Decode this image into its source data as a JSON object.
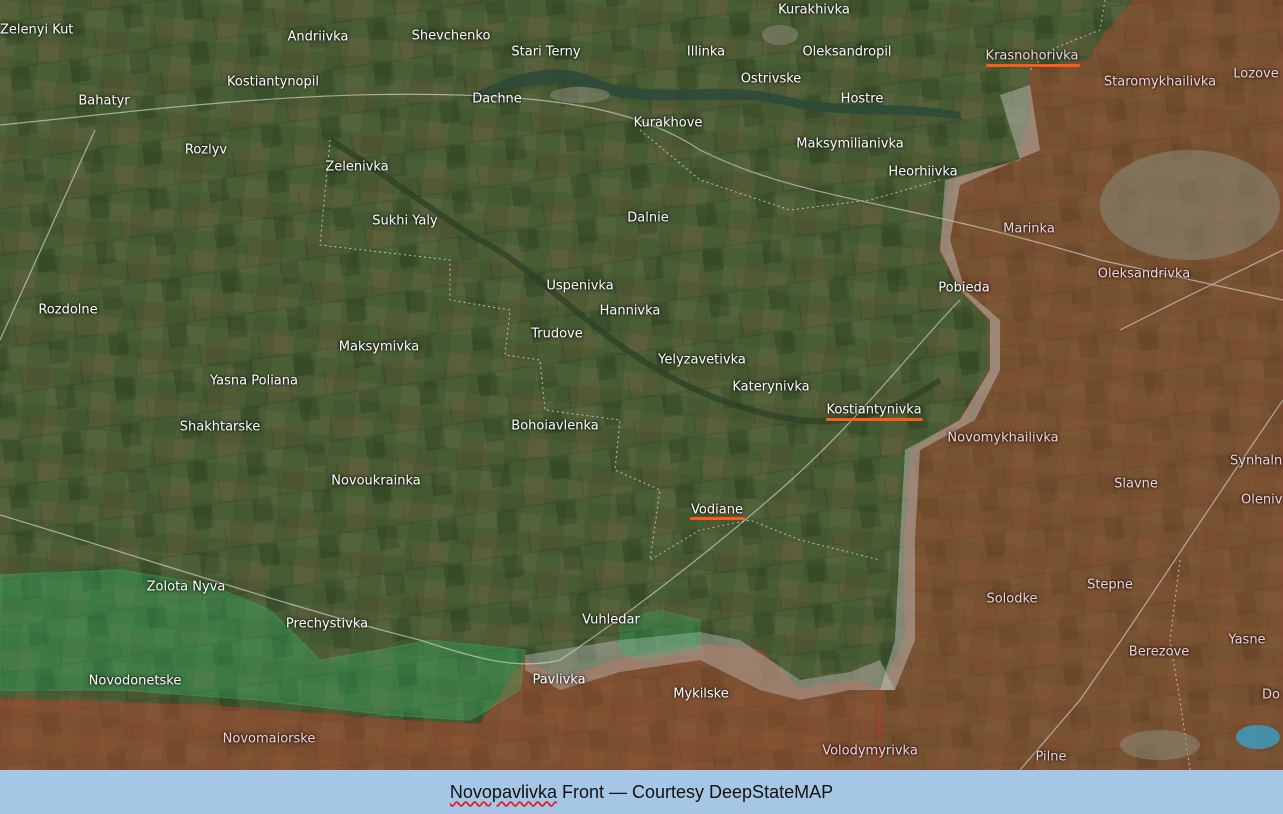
{
  "caption": {
    "title_word": "Novopavlivka",
    "rest": "Front — Courtesy DeepStateMAP"
  },
  "colors": {
    "occupied_fill": "#c0392b",
    "occupied_border": "#e03030",
    "liberated_fill": "#2ecc71",
    "grey_zone": "#bfbfbf",
    "highlight_underline": "#ff5a1a"
  },
  "places": {
    "zelenyi_kut": "Zelenyi Kut",
    "andriivka": "Andriivka",
    "shevchenko": "Shevchenko",
    "stari_terny": "Stari Terny",
    "illinka": "Illinka",
    "kurakhivka": "Kurakhivka",
    "oleksandropil": "Oleksandropil",
    "krasnohorivka": "Krasnohorivka",
    "staromykhailivka": "Staromykhailivka",
    "lozove": "Lozove",
    "bahatyr": "Bahatyr",
    "kostiantynopil": "Kostiantynopil",
    "dachne": "Dachne",
    "ostrivske": "Ostrivske",
    "hostre": "Hostre",
    "kurakhove": "Kurakhove",
    "rozlyv": "Rozlyv",
    "maksymilianivka": "Maksymilianivka",
    "heorhiivka": "Heorhiivka",
    "zelenivka": "Zelenivka",
    "sukhi_yaly": "Sukhi Yaly",
    "dalnie": "Dalnie",
    "marinka": "Marinka",
    "oleksandrivka": "Oleksandrivka",
    "uspenivka": "Uspenivka",
    "pobieda": "Pobieda",
    "rozdolne": "Rozdolne",
    "hannivka": "Hannivka",
    "trudove": "Trudove",
    "maksymivka": "Maksymivka",
    "yelyzavetivka": "Yelyzavetivka",
    "yasna_poliana": "Yasna Poliana",
    "katerynivka": "Katerynivka",
    "kostiantynivka": "Kostiantynivka",
    "shakhtarske": "Shakhtarske",
    "bohoiavlenka": "Bohoiavlenka",
    "novomykhailivka": "Novomykhailivka",
    "synhalne": "Synhaln",
    "novoukrainka": "Novoukrainka",
    "slavne": "Slavne",
    "olenivka": "Oleniv",
    "vodiane": "Vodiane",
    "zolota_nyva": "Zolota Nyva",
    "solodke": "Solodke",
    "stepne": "Stepne",
    "prechystivka": "Prechystivka",
    "vuhledar": "Vuhledar",
    "yasne": "Yasne",
    "berezove": "Berezove",
    "novodonetske": "Novodonetske",
    "pavlivka": "Pavlivka",
    "mykilske": "Mykilske",
    "dokuchaievsk": "Do",
    "novomaiorske": "Novomaiorske",
    "volodymyrivka": "Volodymyrivka",
    "pilne": "Pilne"
  }
}
